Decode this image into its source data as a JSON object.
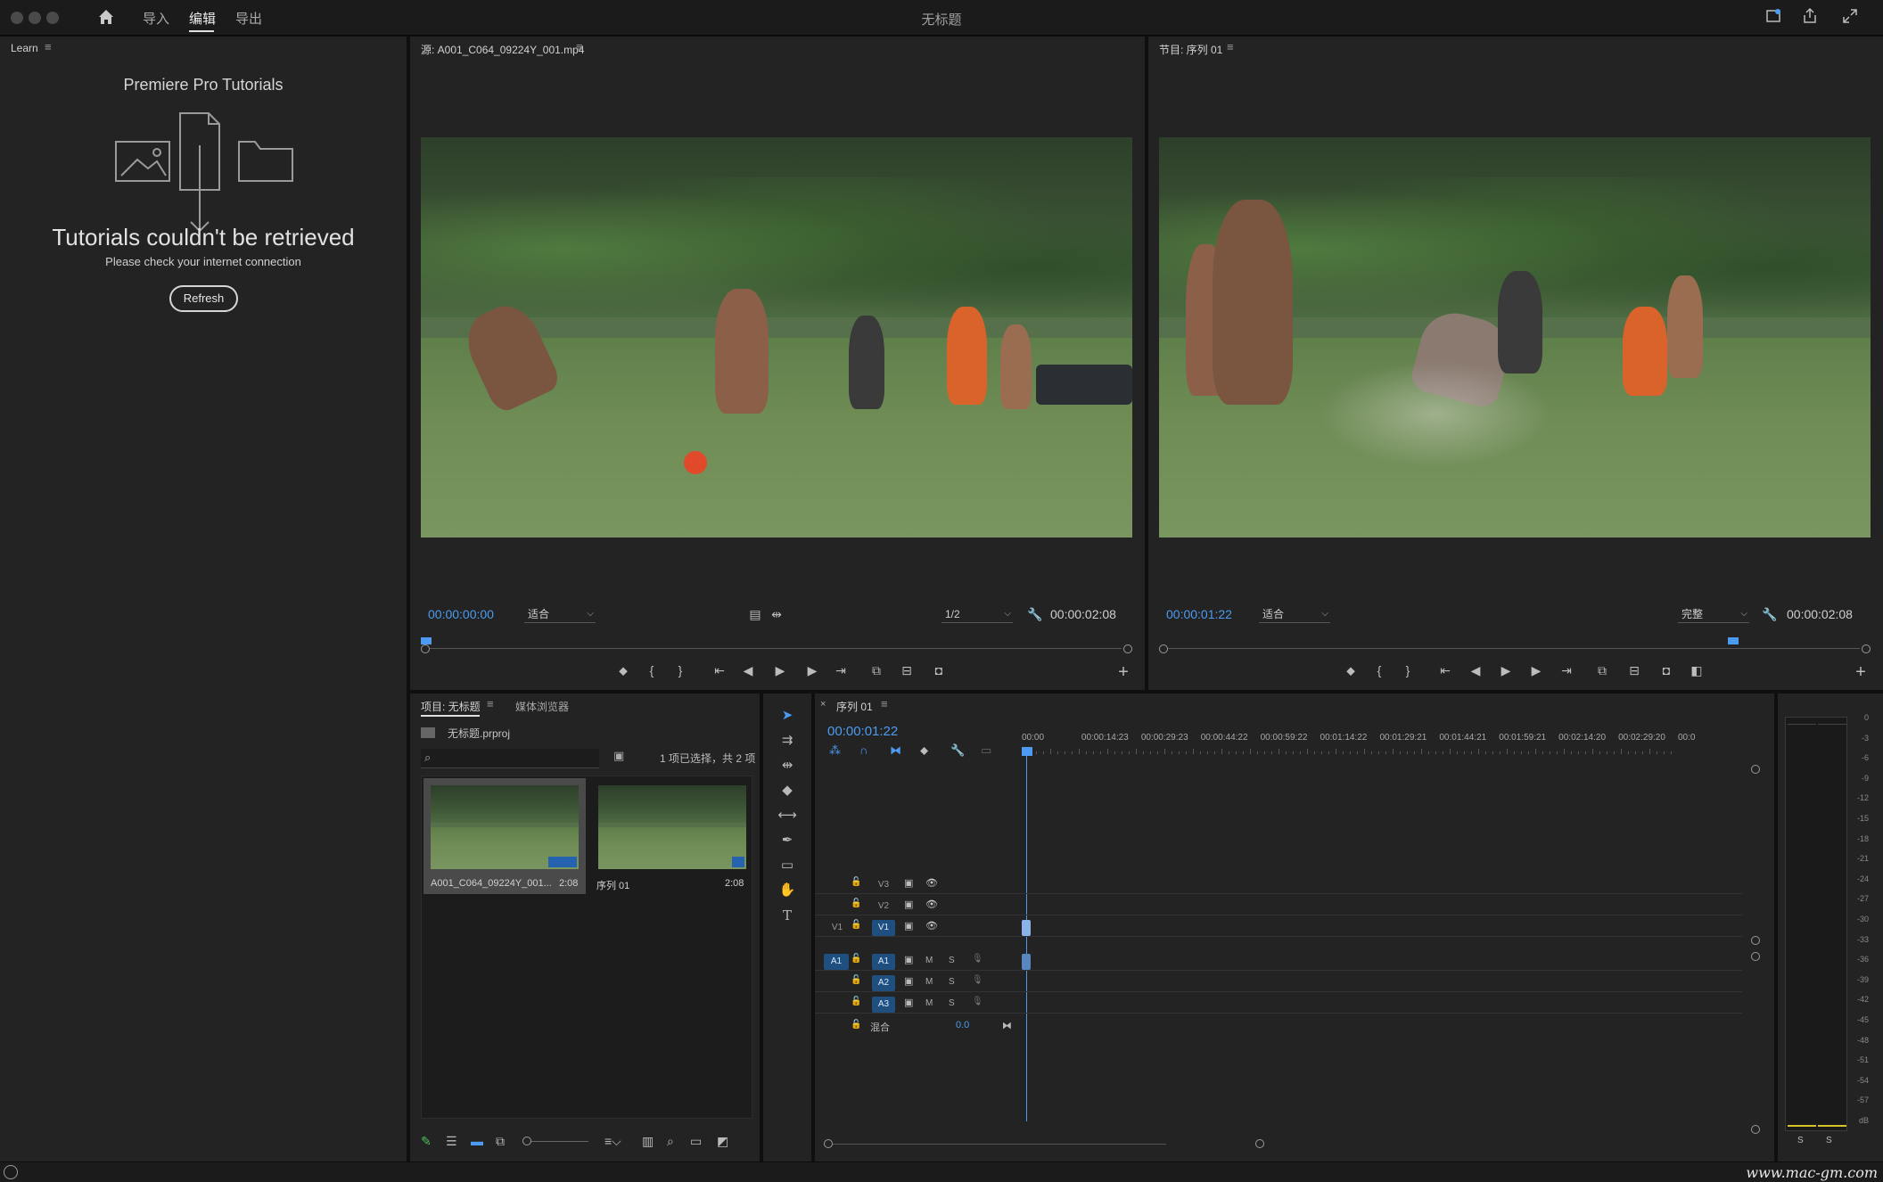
{
  "window": {
    "title": "无标题"
  },
  "nav": {
    "import": "导入",
    "edit": "编辑",
    "export": "导出"
  },
  "learn": {
    "tab": "Learn",
    "heading": "Premiere Pro Tutorials",
    "error_title": "Tutorials couldn't be retrieved",
    "error_sub": "Please check your internet connection",
    "refresh": "Refresh"
  },
  "source": {
    "tab": "源: A001_C064_09224Y_001.mp4",
    "timecode": "00:00:00:00",
    "fit": "适合",
    "resolution": "1/2",
    "duration": "00:00:02:08"
  },
  "program": {
    "tab": "节目: 序列 01",
    "timecode": "00:00:01:22",
    "fit": "适合",
    "resolution": "完整",
    "duration": "00:00:02:08"
  },
  "project": {
    "tab": "项目: 无标题",
    "tab2": "媒体浏览器",
    "file": "无标题.prproj",
    "selection": "1 项已选择，共 2 项",
    "items": [
      {
        "name": "A001_C064_09224Y_001...",
        "duration": "2:08"
      },
      {
        "name": "序列 01",
        "duration": "2:08"
      }
    ]
  },
  "timeline": {
    "tab": "序列 01",
    "timecode": "00:00:01:22",
    "ruler": [
      "00:00",
      "00:00:14:23",
      "00:00:29:23",
      "00:00:44:22",
      "00:00:59:22",
      "00:01:14:22",
      "00:01:29:21",
      "00:01:44:21",
      "00:01:59:21",
      "00:02:14:20",
      "00:02:29:20",
      "00:0"
    ],
    "video_tracks": [
      "V3",
      "V2",
      "V1"
    ],
    "audio_tracks": [
      "A1",
      "A2",
      "A3"
    ],
    "source_v": "V1",
    "source_a": "A1",
    "mix_label": "混合",
    "mix_value": "0.0",
    "mute": "M",
    "solo": "S"
  },
  "meter": {
    "labels": [
      "0",
      "-3",
      "-6",
      "-9",
      "-12",
      "-15",
      "-18",
      "-21",
      "-24",
      "-27",
      "-30",
      "-33",
      "-36",
      "-39",
      "-42",
      "-45",
      "-48",
      "-51",
      "-54",
      "-57",
      "dB"
    ],
    "solo_left": "S",
    "solo_right": "S"
  },
  "watermark": "www.mac-gm.com"
}
